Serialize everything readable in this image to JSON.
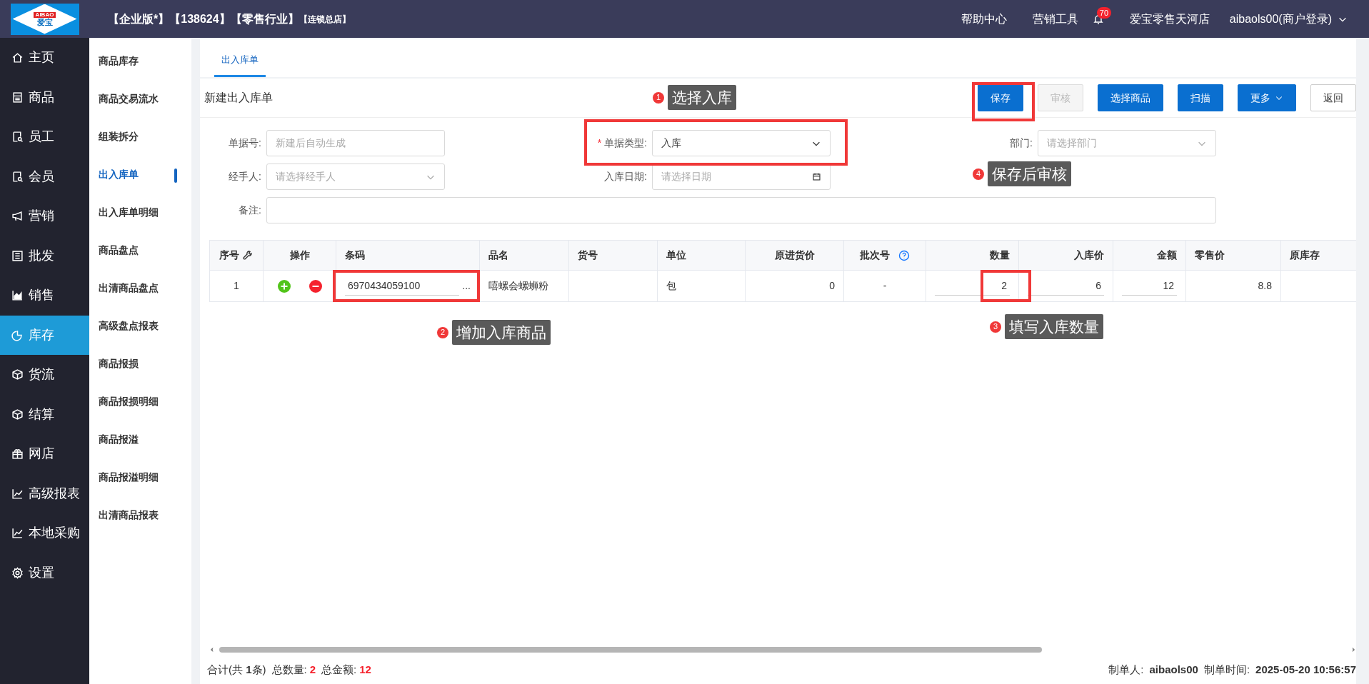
{
  "logo": {
    "text": "AIBAO",
    "subtext": "爱宝"
  },
  "header": {
    "tags": [
      {
        "text": "【企业版*】【138624】【零售行业】",
        "kind": "main"
      },
      {
        "text": "【连锁总店】",
        "kind": "minor"
      }
    ],
    "links": [
      "帮助中心",
      "营销工具"
    ],
    "notifications": "70",
    "store": "爱宝零售天河店",
    "user": "aibaols00(商户登录)"
  },
  "nav": [
    {
      "label": "主页",
      "selected": false
    },
    {
      "label": "商品",
      "selected": false
    },
    {
      "label": "员工",
      "selected": false
    },
    {
      "label": "会员",
      "selected": false
    },
    {
      "label": "营销",
      "selected": false
    },
    {
      "label": "批发",
      "selected": false
    },
    {
      "label": "销售",
      "selected": false
    },
    {
      "label": "库存",
      "selected": true
    },
    {
      "label": "货流",
      "selected": false
    },
    {
      "label": "结算",
      "selected": false
    },
    {
      "label": "网店",
      "selected": false
    },
    {
      "label": "高级报表",
      "selected": false
    },
    {
      "label": "本地采购",
      "selected": false
    },
    {
      "label": "设置",
      "selected": false
    }
  ],
  "submenu": [
    {
      "label": "商品库存",
      "selected": false
    },
    {
      "label": "商品交易流水",
      "selected": false
    },
    {
      "label": "组装拆分",
      "selected": false
    },
    {
      "label": "出入库单",
      "selected": true
    },
    {
      "label": "出入库单明细",
      "selected": false
    },
    {
      "label": "商品盘点",
      "selected": false
    },
    {
      "label": "出清商品盘点",
      "selected": false
    },
    {
      "label": "高级盘点报表",
      "selected": false
    },
    {
      "label": "商品报损",
      "selected": false
    },
    {
      "label": "商品报损明细",
      "selected": false
    },
    {
      "label": "商品报溢",
      "selected": false
    },
    {
      "label": "商品报溢明细",
      "selected": false
    },
    {
      "label": "出清商品报表",
      "selected": false
    }
  ],
  "tabs": [
    {
      "label": "出入库单",
      "selected": true
    }
  ],
  "page_title": "新建出入库单",
  "buttons": [
    {
      "label": "保存",
      "kind": "primary",
      "disabled": false
    },
    {
      "label": "审核",
      "kind": "primary",
      "disabled": true
    },
    {
      "label": "选择商品",
      "kind": "primary",
      "disabled": false
    },
    {
      "label": "扫描",
      "kind": "primary",
      "disabled": false
    },
    {
      "label": "更多",
      "kind": "dropdown",
      "disabled": false
    },
    {
      "label": "返回",
      "kind": "outline",
      "disabled": false
    }
  ],
  "form": [
    [
      {
        "label": "单据号:",
        "kind": "text",
        "placeholder": "新建后自动生成"
      },
      {
        "label": "单据类型:",
        "kind": "select",
        "value": "入库",
        "required_mark": "*"
      },
      {
        "label": "部门:",
        "kind": "select",
        "placeholder": "请选择部门"
      }
    ],
    [
      {
        "label": "经手人:",
        "kind": "select",
        "placeholder": "请选择经手人"
      },
      {
        "label": "入库日期:",
        "kind": "date",
        "placeholder": "请选择日期"
      }
    ],
    [
      {
        "label": "备注:",
        "kind": "wide"
      }
    ]
  ],
  "table": {
    "columns": [
      "序号",
      "操作",
      "条码",
      "品名",
      "货号",
      "单位",
      "原进货价",
      "批次号",
      "数量",
      "入库价",
      "金额",
      "零售价",
      "原库存"
    ],
    "rows": [
      [
        {
          "kind": "text",
          "value": "1"
        },
        {
          "kind": "actions"
        },
        {
          "kind": "barcode",
          "value": "6970434059100",
          "suffix": "..."
        },
        {
          "kind": "text",
          "value": "嘻螺会螺蛳粉"
        },
        {
          "kind": "blank"
        },
        {
          "kind": "text",
          "value": "包"
        },
        {
          "kind": "text",
          "value": "0"
        },
        {
          "kind": "text",
          "value": "-"
        },
        {
          "kind": "input",
          "value": "2"
        },
        {
          "kind": "input",
          "value": "6"
        },
        {
          "kind": "input",
          "value": "12"
        },
        {
          "kind": "text",
          "value": "8.8"
        },
        {
          "kind": "blank"
        }
      ]
    ]
  },
  "footer": {
    "summary": "合计(共 **1**条)",
    "totals": [
      {
        "label": "总数量:",
        "value": "2"
      },
      {
        "label": "总金额:",
        "value": "12"
      }
    ],
    "meta": [
      {
        "label": "制单人:",
        "value": "aibaols00"
      },
      {
        "label": "制单时间:",
        "value": "2025-05-20 10:56:57"
      }
    ]
  },
  "annotations": [
    {
      "number": "1",
      "text": "选择入库"
    },
    {
      "number": "4",
      "text": "保存后审核"
    },
    {
      "number": "2",
      "text": "增加入库商品"
    },
    {
      "number": "3",
      "text": "填写入库数量"
    }
  ]
}
